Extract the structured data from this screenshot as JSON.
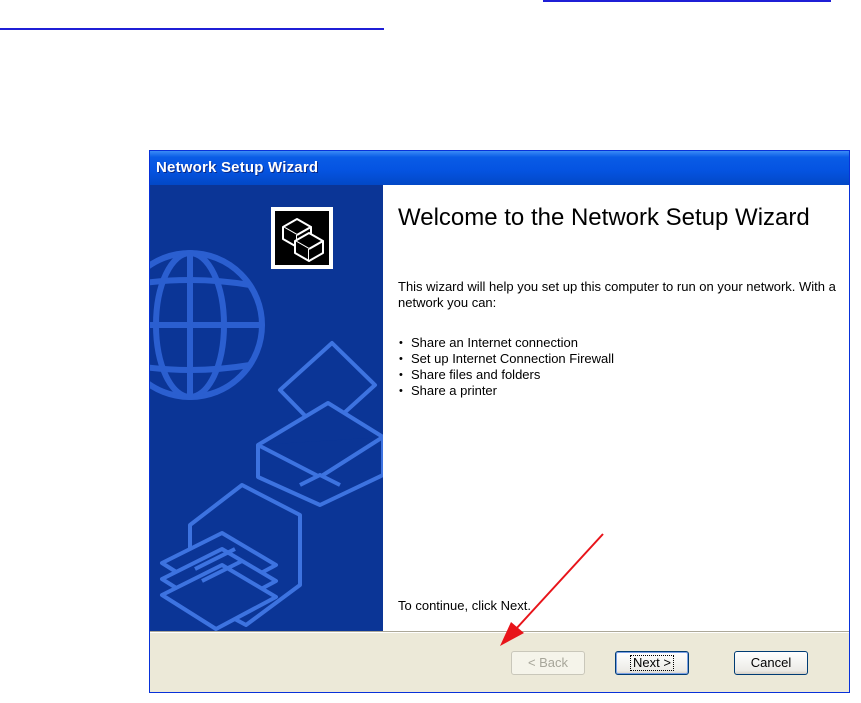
{
  "window": {
    "title": "Network Setup Wizard"
  },
  "content": {
    "heading": "Welcome to the Network Setup Wizard",
    "intro": "This wizard will help you set up this computer to run on your network. With a network you can:",
    "features": [
      "Share an Internet connection",
      "Set up Internet Connection Firewall",
      "Share files and folders",
      "Share a printer"
    ],
    "continue_hint": "To continue, click Next."
  },
  "buttons": {
    "back": "< Back",
    "next": "Next >",
    "cancel": "Cancel"
  },
  "icons": {
    "wizard": "network-computers-icon",
    "globe": "globe-icon",
    "printer": "printer-icon",
    "folder": "folder-icon",
    "arrow": "red-arrow-annotation"
  },
  "colors": {
    "title_bar": "#0554e2",
    "side_panel": "#0b3596",
    "annotation_arrow": "#e8141a",
    "hyperlink_rule": "#1f1fd6"
  }
}
